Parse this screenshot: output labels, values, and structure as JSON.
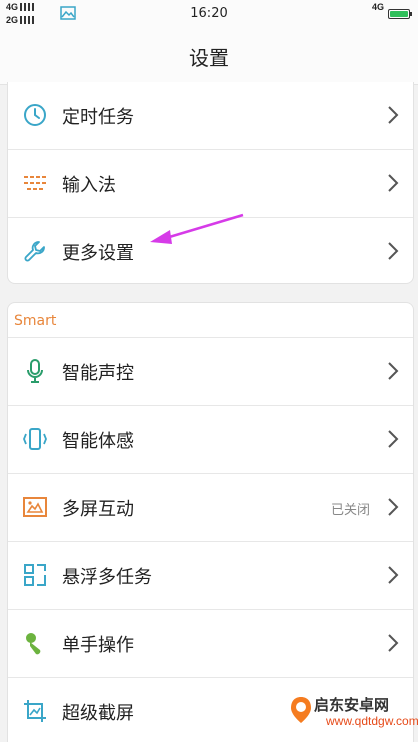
{
  "status_bar": {
    "network_top": "4G",
    "network_bottom": "2G",
    "time": "16:20",
    "network_right": "4G"
  },
  "header": {
    "title": "设置"
  },
  "group1": {
    "items": [
      {
        "label": "定时任务",
        "icon": "clock-icon"
      },
      {
        "label": "输入法",
        "icon": "keyboard-icon"
      },
      {
        "label": "更多设置",
        "icon": "wrench-icon"
      }
    ]
  },
  "group2": {
    "section_title": "Smart",
    "items": [
      {
        "label": "智能声控",
        "icon": "microphone-icon"
      },
      {
        "label": "智能体感",
        "icon": "phone-gesture-icon"
      },
      {
        "label": "多屏互动",
        "icon": "multi-screen-icon",
        "status": "已关闭"
      },
      {
        "label": "悬浮多任务",
        "icon": "floating-window-icon"
      },
      {
        "label": "单手操作",
        "icon": "one-hand-icon"
      },
      {
        "label": "超级截屏",
        "icon": "screenshot-icon"
      }
    ]
  },
  "colors": {
    "accent": "#3aa6c8",
    "section_title": "#e8863b",
    "arrow": "#d63be8"
  },
  "watermark": {
    "name": "启东安卓网",
    "url": "www.qdtdgw.com"
  }
}
